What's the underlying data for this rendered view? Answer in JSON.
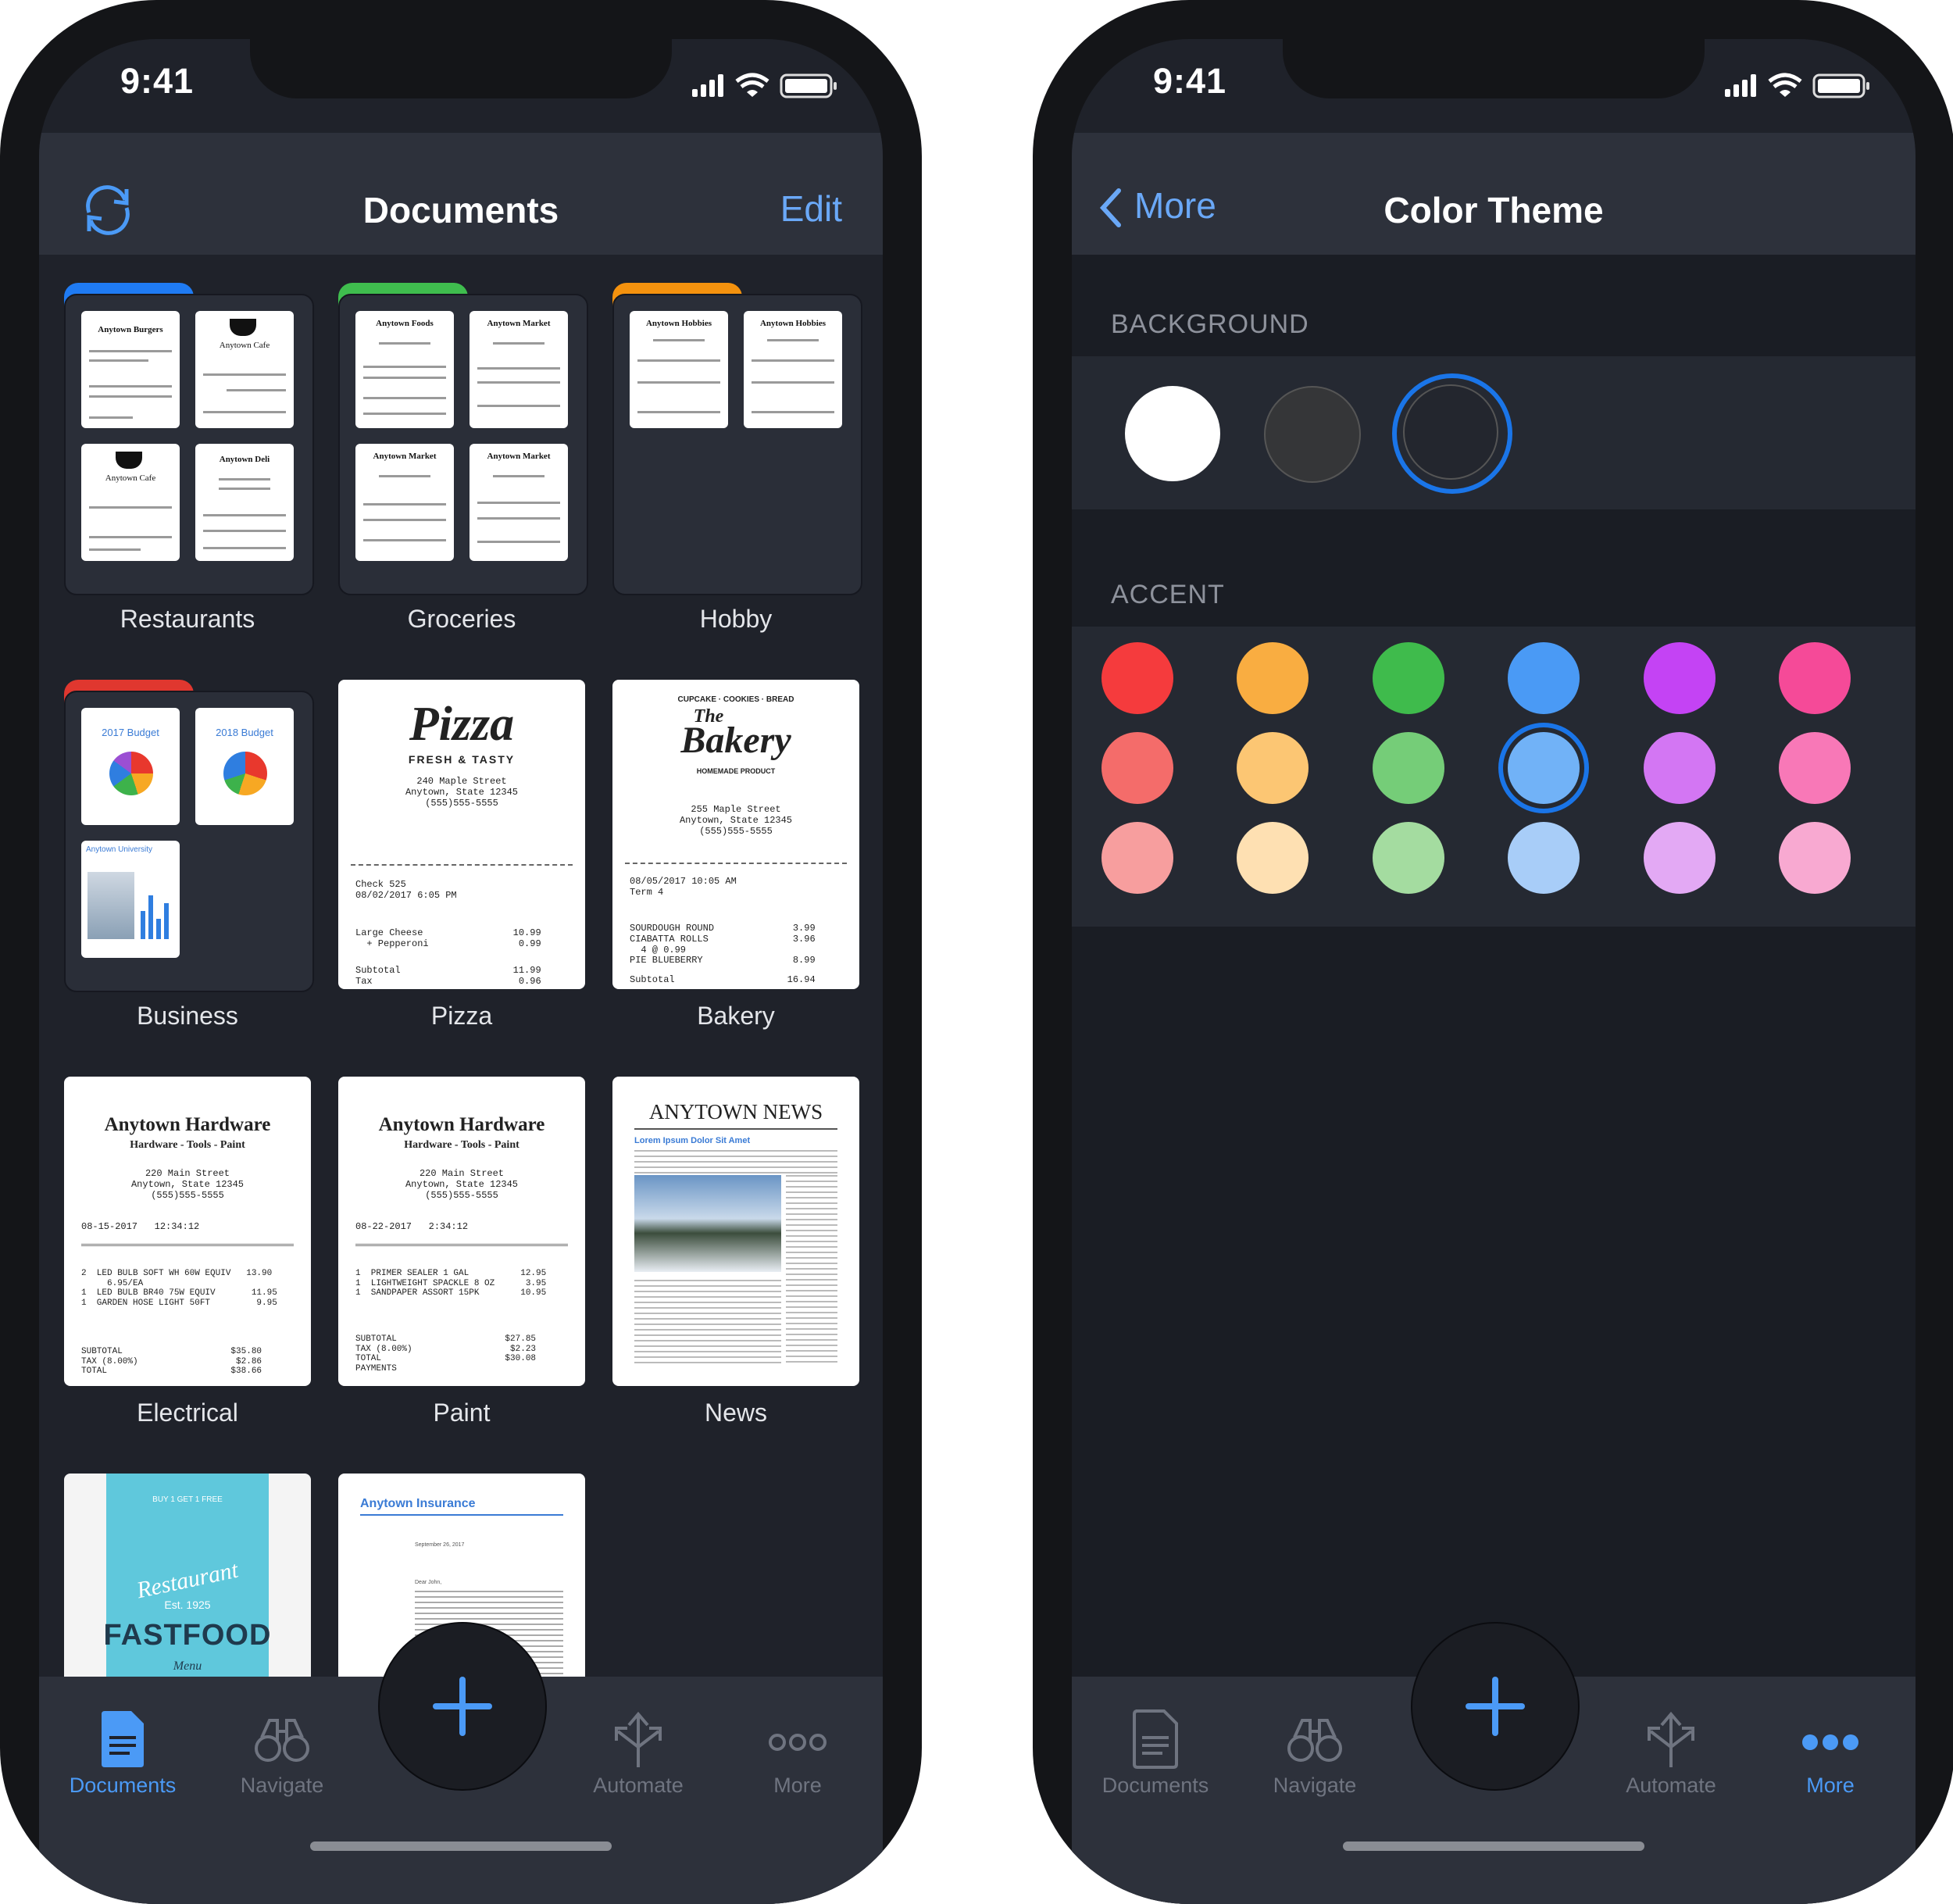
{
  "status_time": "9:41",
  "left": {
    "nav": {
      "title": "Documents",
      "edit_label": "Edit",
      "sync_icon": "sync-icon"
    },
    "tiles": [
      {
        "caption": "Restaurants",
        "type": "folder",
        "tab_color": "#1f7bf3"
      },
      {
        "caption": "Groceries",
        "type": "folder",
        "tab_color": "#3fbd4e"
      },
      {
        "caption": "Hobby",
        "type": "folder",
        "tab_color": "#f4920e"
      },
      {
        "caption": "Business",
        "type": "folder",
        "tab_color": "#e0372f"
      },
      {
        "caption": "Pizza",
        "type": "doc"
      },
      {
        "caption": "Bakery",
        "type": "doc"
      },
      {
        "caption": "Electrical",
        "type": "doc"
      },
      {
        "caption": "Paint",
        "type": "doc"
      },
      {
        "caption": "News",
        "type": "doc"
      }
    ],
    "restaurants_minis": [
      "Anytown Burgers",
      "Anytown Cafe",
      "Anytown Cafe",
      "Anytown Deli"
    ],
    "groceries_minis": [
      "Anytown Foods",
      "Anytown Market",
      "Anytown Market",
      "Anytown Market"
    ],
    "hobby_minis": [
      "Anytown Hobbies",
      "Anytown Hobbies"
    ],
    "business_minis": [
      "2017 Budget",
      "2018 Budget",
      "Anytown University"
    ],
    "pizza": {
      "brand": "Pizza",
      "tagline": "FRESH & TASTY",
      "address": "240 Maple Street\nAnytown, State 12345\n(555)555-5555",
      "check": "Check 525\n08/02/2017 6:05 PM",
      "items": "Large Cheese                10.99\n  + Pepperoni                0.99",
      "totals": "Subtotal                    11.99\nTax                          0.96"
    },
    "bakery": {
      "top": "CUPCAKE · COOKIES · BREAD",
      "brand1": "The",
      "brand2": "Bakery",
      "sub": "HOMEMADE PRODUCT",
      "address": "255 Maple Street\nAnytown, State 12345\n(555)555-5555",
      "date": "08/05/2017 10:05 AM\nTerm 4",
      "items": "SOURDOUGH ROUND              3.99\nCIABATTA ROLLS               3.96\n  4 @ 0.99\nPIE BLUEBERRY                8.99",
      "totals": "Subtotal                    16.94"
    },
    "electrical": {
      "title": "Anytown Hardware",
      "sub": "Hardware - Tools - Paint",
      "address": "220 Main Street\nAnytown, State 12345\n(555)555-5555",
      "date": "08-15-2017   12:34:12",
      "items": "2  LED BULB SOFT WH 60W EQUIV   13.90\n     6.95/EA\n1  LED BULB BR40 75W EQUIV       11.95\n1  GARDEN HOSE LIGHT 50FT         9.95",
      "totals": "SUBTOTAL                     $35.80\nTAX (8.00%)                   $2.86\nTOTAL                        $38.66"
    },
    "paint": {
      "title": "Anytown Hardware",
      "sub": "Hardware - Tools - Paint",
      "address": "220 Main Street\nAnytown, State 12345\n(555)555-5555",
      "date": "08-22-2017   2:34:12",
      "items": "1  PRIMER SEALER 1 GAL          12.95\n1  LIGHTWEIGHT SPACKLE 8 OZ      3.95\n1  SANDPAPER ASSORT 15PK        10.95",
      "totals": "SUBTOTAL                     $27.85\nTAX (8.00%)                   $2.23\nTOTAL                        $30.08\nPAYMENTS"
    },
    "news": {
      "masthead": "ANYTOWN NEWS",
      "headline": "Lorem Ipsum Dolor Sit Amet"
    },
    "fastfood": {
      "top": "BUY 1 GET 1 FREE",
      "script": "Restaurant",
      "est": "Est. 1925",
      "brand": "FASTFOOD",
      "menu": "Menu"
    },
    "insurance": {
      "title": "Anytown Insurance",
      "date": "September 26, 2017",
      "greeting": "Dear John,"
    }
  },
  "right": {
    "nav": {
      "back_label": "More",
      "title": "Color Theme"
    },
    "background_label": "BACKGROUND",
    "accent_label": "ACCENT",
    "backgrounds": [
      {
        "name": "white",
        "color": "#ffffff",
        "selected": false
      },
      {
        "name": "dark-gray",
        "color": "#353638",
        "selected": false
      },
      {
        "name": "navy-dark",
        "color": "#23262e",
        "selected": true
      }
    ],
    "accent_rows": [
      [
        "#f53b3d",
        "#f9ad41",
        "#3fbb4c",
        "#4a9af5",
        "#c443f4",
        "#f54a98"
      ],
      [
        "#f46c6a",
        "#fcc673",
        "#75cd78",
        "#71b2f7",
        "#d376f3",
        "#f878b7"
      ],
      [
        "#f79e9e",
        "#fee0b2",
        "#a4dca0",
        "#a8cdf8",
        "#e3a9f4",
        "#f8a9d1"
      ]
    ],
    "accent_selected": {
      "row": 1,
      "col": 3
    },
    "selection_color": "#1a75e8"
  },
  "tabbar": {
    "items_left": [
      {
        "label": "Documents",
        "icon": "document-icon",
        "active": true
      },
      {
        "label": "Navigate",
        "icon": "binoculars-icon",
        "active": false
      },
      {
        "label": "Automate",
        "icon": "automate-arrows-icon",
        "active": false
      },
      {
        "label": "More",
        "icon": "more-dots-icon",
        "active": false
      }
    ],
    "items_right": [
      {
        "label": "Documents",
        "icon": "document-icon",
        "active": false
      },
      {
        "label": "Navigate",
        "icon": "binoculars-icon",
        "active": false
      },
      {
        "label": "Automate",
        "icon": "automate-arrows-icon",
        "active": false
      },
      {
        "label": "More",
        "icon": "more-dots-icon",
        "active": true
      }
    ],
    "add_icon": "plus-icon"
  }
}
